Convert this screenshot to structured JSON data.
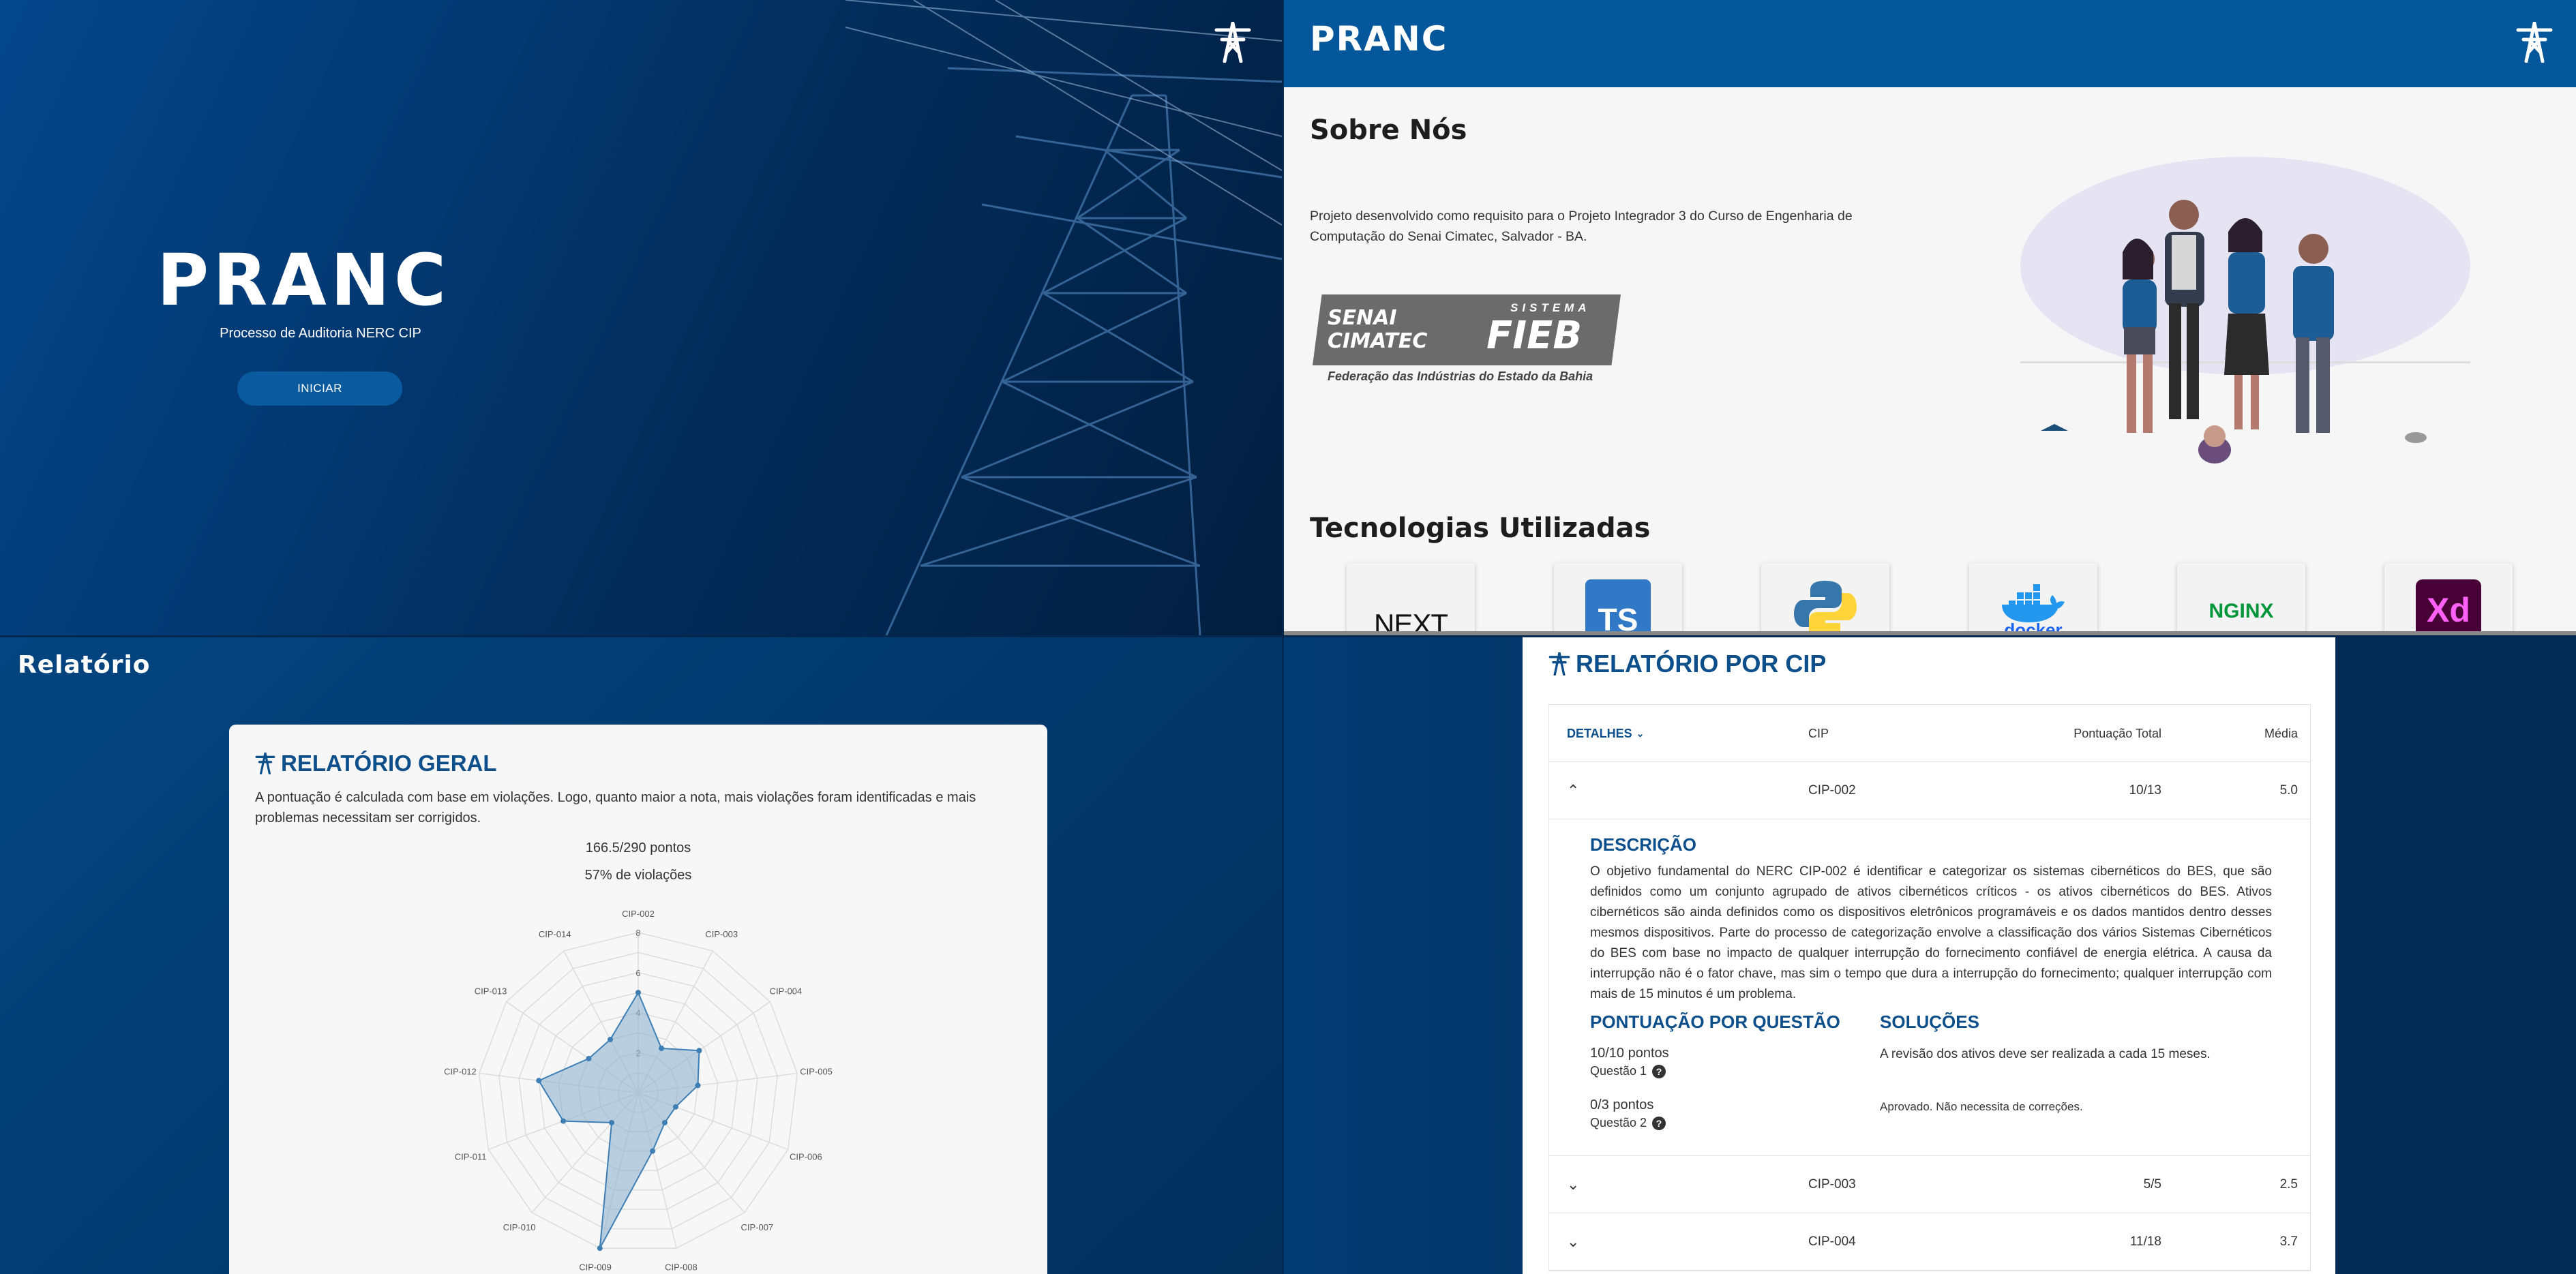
{
  "landing": {
    "brand": "PRANC",
    "subtitle": "Processo de Auditoria NERC CIP",
    "start_button": "INICIAR"
  },
  "about": {
    "brand": "PRANC",
    "title": "Sobre Nós",
    "description": "Projeto desenvolvido como requisito para o Projeto Integrador 3 do Curso de Engenharia de Computação do Senai Cimatec, Salvador - BA.",
    "logo": {
      "senai": "SENAI",
      "cimatec": "CIMATEC",
      "sistema": "SISTEMA",
      "fieb": "FIEB",
      "caption": "Federação das Indústrias do Estado da Bahia"
    },
    "tech_title": "Tecnologias Utilizadas",
    "technologies": [
      "next-logo",
      "typescript-logo",
      "python-logo",
      "docker-logo",
      "nginx-logo",
      "adobe-xd-logo"
    ],
    "tech_labels": {
      "next": "NEXT",
      "ts": "TS",
      "docker": "docker",
      "nginx": "NGINX",
      "xd": "Xd"
    }
  },
  "report": {
    "page_title": "Relatório",
    "card_title": "RELATÓRIO GERAL",
    "card_description": "A pontuação é calculada com base em violações. Logo, quanto maior a nota, mais violações foram identificadas e mais problemas necessitam ser corrigidos.",
    "points": "166.5/290 pontos",
    "violations": "57% de violações"
  },
  "chart_data": {
    "type": "radar",
    "categories": [
      "CIP-002",
      "CIP-003",
      "CIP-004",
      "CIP-005",
      "CIP-006",
      "CIP-007",
      "CIP-008",
      "CIP-009",
      "CIP-010",
      "CIP-011",
      "CIP-012",
      "CIP-013",
      "CIP-014"
    ],
    "values": [
      5,
      2.5,
      3.7,
      3,
      2,
      2,
      3,
      8,
      2,
      4,
      5,
      3,
      3
    ],
    "rlim": [
      0,
      8
    ],
    "ticks": [
      2,
      4,
      6,
      8
    ],
    "title": "",
    "grid": true,
    "colors": {
      "fill": "#8fb3cf",
      "stroke": "#3d7eb5"
    }
  },
  "cip_report": {
    "title": "RELATÓRIO POR CIP",
    "columns": {
      "details": "DETALHES",
      "cip": "CIP",
      "total": "Pontuação Total",
      "avg": "Média"
    },
    "rows": [
      {
        "cip": "CIP-002",
        "total": "10/13",
        "avg": "5.0"
      },
      {
        "cip": "CIP-003",
        "total": "5/5",
        "avg": "2.5"
      },
      {
        "cip": "CIP-004",
        "total": "11/18",
        "avg": "3.7"
      }
    ],
    "expanded": {
      "desc_title": "DESCRIÇÃO",
      "description": "O objetivo fundamental do NERC CIP-002 é identificar e categorizar os sistemas cibernéticos do BES, que são definidos como um conjunto agrupado de ativos cibernéticos críticos - os ativos cibernéticos do BES. Ativos cibernéticos são ainda definidos como os dispositivos eletrônicos programáveis e os dados mantidos dentro desses mesmos dispositivos. Parte do processo de categorização envolve a classificação dos vários Sistemas Cibernéticos do BES com base no impacto de qualquer interrupção do fornecimento confiável de energia elétrica. A causa da interrupção não é o fator chave, mas sim o tempo que dura a interrupção do fornecimento; qualquer interrupção com mais de 15 minutos é um problema.",
      "score_title": "PONTUAÇÃO POR QUESTÃO",
      "solutions_title": "SOLUÇÕES",
      "questions": [
        {
          "points": "10/10 pontos",
          "label": "Questão 1",
          "solution": "A revisão dos ativos deve ser realizada a cada 15 meses."
        },
        {
          "points": "0/3 pontos",
          "label": "Questão 2",
          "solution": "Aprovado. Não necessita de correções."
        }
      ]
    }
  },
  "colors": {
    "primary": "#04579a",
    "accent": "#0d4f8b",
    "dark": "#032d5b"
  }
}
